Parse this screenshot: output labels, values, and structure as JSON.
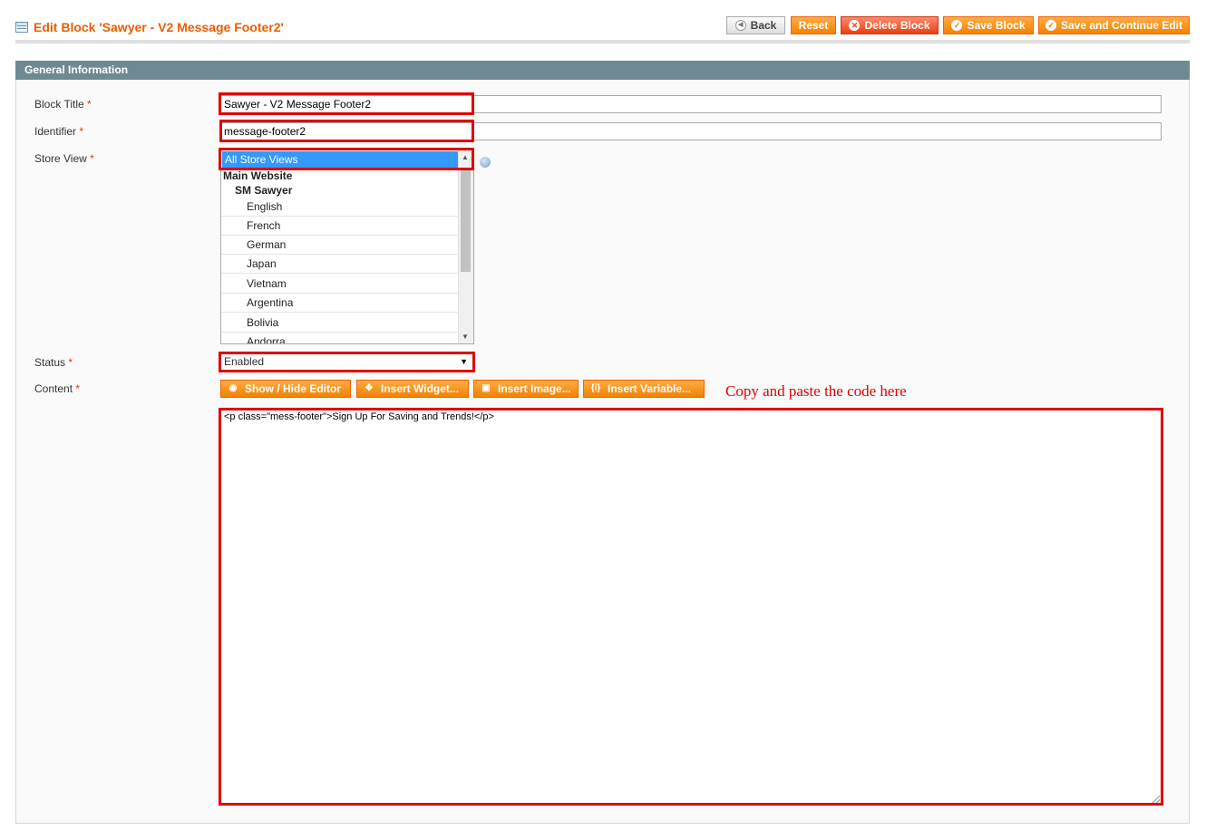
{
  "header": {
    "title": "Edit Block 'Sawyer - V2 Message Footer2'",
    "buttons": {
      "back": "Back",
      "reset": "Reset",
      "delete": "Delete Block",
      "save": "Save Block",
      "save_continue": "Save and Continue Edit"
    }
  },
  "section": {
    "title": "General Information"
  },
  "form": {
    "block_title": {
      "label": "Block Title",
      "value": "Sawyer - V2 Message Footer2"
    },
    "identifier": {
      "label": "Identifier",
      "value": "message-footer2"
    },
    "store_view": {
      "label": "Store View",
      "selected": "All Store Views",
      "website": "Main Website",
      "store": "SM Sawyer",
      "options": [
        "English",
        "French",
        "German",
        "Japan",
        "Vietnam",
        "Argentina",
        "Bolivia",
        "Andorra"
      ]
    },
    "status": {
      "label": "Status",
      "value": "Enabled"
    },
    "content": {
      "label": "Content",
      "value": "<p class=\"mess-footer\">Sign Up For Saving and Trends!</p>"
    },
    "required_mark": "*"
  },
  "editor_buttons": {
    "show_hide": "Show / Hide Editor",
    "widget": "Insert Widget...",
    "image": "Insert Image...",
    "variable": "Insert Variable..."
  },
  "annotation": "Copy and paste the code here",
  "colors": {
    "accent": "#eb5e00",
    "button": "#f18200",
    "highlight": "#e00000",
    "section_bar": "#6f8992"
  }
}
